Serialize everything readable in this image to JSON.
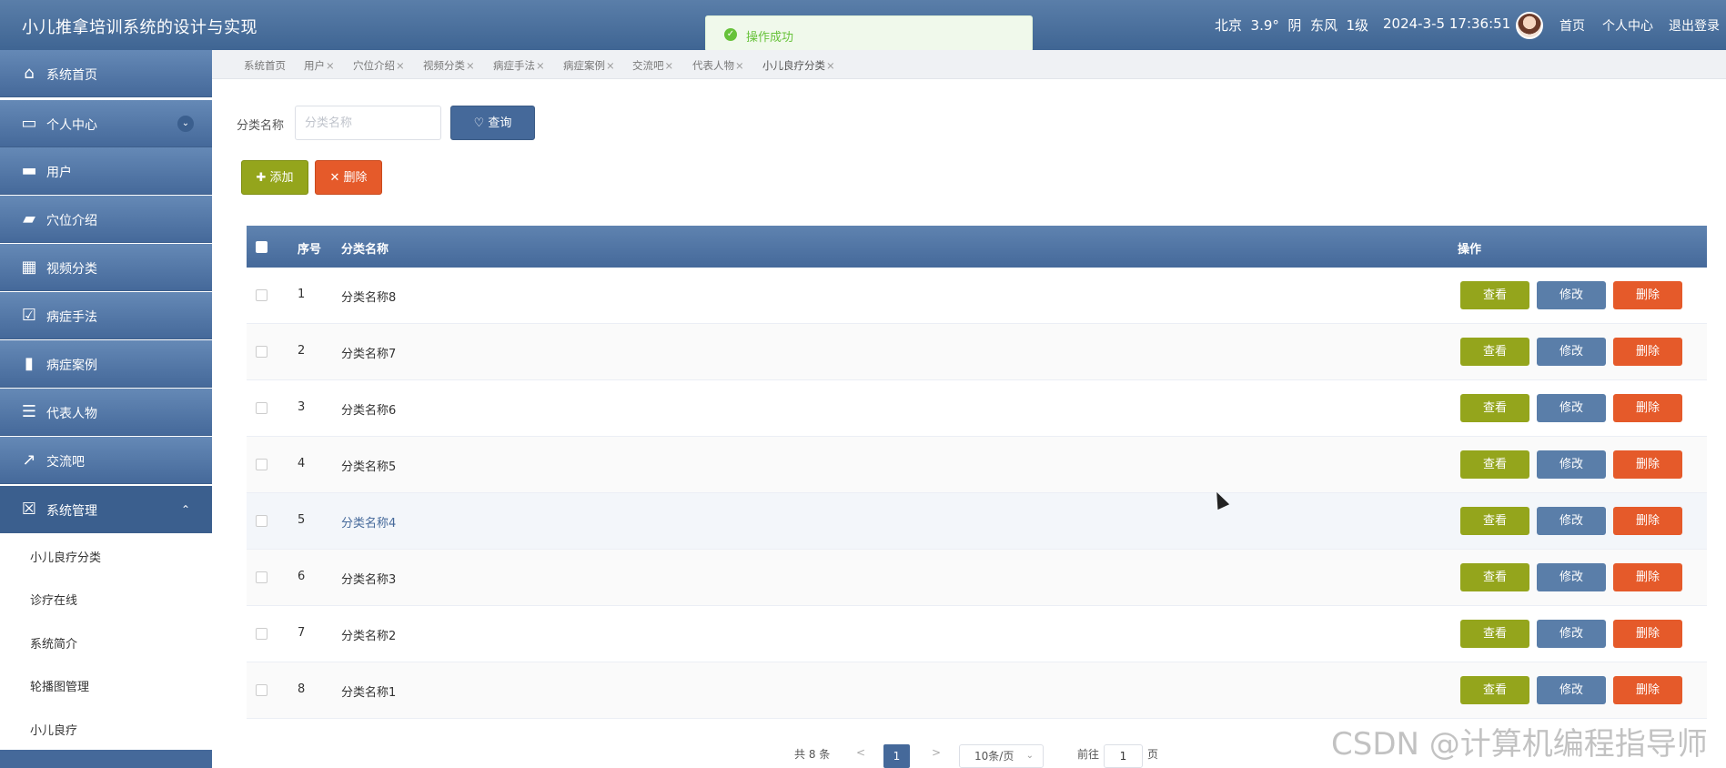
{
  "header": {
    "title": "小儿推拿培训系统的设计与实现",
    "weather": "北京  3.9°  阴  东风  1级",
    "datetime": "2024-3-5 17:36:51",
    "links": [
      "首页",
      "个人中心",
      "退出登录"
    ]
  },
  "toast": {
    "message": "操作成功"
  },
  "sidebar": {
    "items": [
      {
        "label": "系统首页",
        "icon": "home-icon"
      },
      {
        "label": "个人中心",
        "icon": "wallet-icon"
      },
      {
        "label": "用户",
        "icon": "briefcase-icon"
      },
      {
        "label": "穴位介绍",
        "icon": "ticket-icon"
      },
      {
        "label": "视频分类",
        "icon": "grid-icon"
      },
      {
        "label": "病症手法",
        "icon": "clipboard-check-icon"
      },
      {
        "label": "病症案例",
        "icon": "bar-chart-icon"
      },
      {
        "label": "代表人物",
        "icon": "clipboard-list-icon"
      },
      {
        "label": "交流吧",
        "icon": "trend-icon"
      },
      {
        "label": "系统管理",
        "icon": "clipboard-x-icon"
      }
    ],
    "subitems": [
      "小儿良疗分类",
      "诊疗在线",
      "系统简介",
      "轮播图管理",
      "小儿良疗"
    ]
  },
  "tabs": [
    "系统首页",
    "用户",
    "穴位介绍",
    "视频分类",
    "病症手法",
    "病症案例",
    "交流吧",
    "代表人物",
    "小儿良疗分类"
  ],
  "search": {
    "label": "分类名称",
    "placeholder": "分类名称",
    "query_label": "查询"
  },
  "actions": {
    "add_label": "添加",
    "delete_label": "删除"
  },
  "table": {
    "columns": [
      "序号",
      "分类名称",
      "操作"
    ],
    "rows": [
      {
        "index": "1",
        "name": "分类名称8"
      },
      {
        "index": "2",
        "name": "分类名称7"
      },
      {
        "index": "3",
        "name": "分类名称6"
      },
      {
        "index": "4",
        "name": "分类名称5"
      },
      {
        "index": "5",
        "name": "分类名称4"
      },
      {
        "index": "6",
        "name": "分类名称3"
      },
      {
        "index": "7",
        "name": "分类名称2"
      },
      {
        "index": "8",
        "name": "分类名称1"
      }
    ],
    "row_actions": {
      "view": "查看",
      "edit": "修改",
      "delete": "删除"
    }
  },
  "pagination": {
    "total_text": "共 8 条",
    "prev": "<",
    "current_page": "1",
    "next": ">",
    "page_size": "10条/页",
    "goto_label": "前往",
    "goto_value": "1",
    "page_suffix": "页"
  },
  "watermark": "CSDN @计算机编程指导师",
  "colors": {
    "primary": "#45699a",
    "green": "#94a51c",
    "red": "#e55a2a",
    "success": "#67c23a"
  }
}
